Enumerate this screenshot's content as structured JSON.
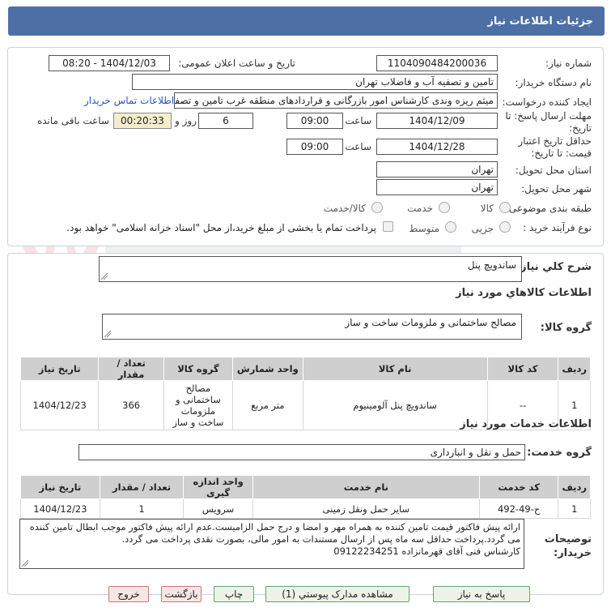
{
  "header": {
    "title": "جزئیات اطلاعات نیاز"
  },
  "labels": {
    "need_number": "شماره نیاز:",
    "announce_datetime": "تاریخ و ساعت اعلان عمومی:",
    "buyer_org": "نام دستگاه خریدار:",
    "request_creator": "ایجاد کننده درخواست:",
    "reply_deadline": "مهلت ارسال پاسخ: تا تاریخ:",
    "price_validity": "حداقل تاریخ اعتبار قیمت: تا تاریخ:",
    "time_word": "ساعت",
    "day_and": "روز و",
    "remaining": "ساعت باقی مانده",
    "delivery_province": "استان محل تحویل:",
    "delivery_city": "شهر محل تحویل:",
    "category": "طبقه بندی موضوعی:",
    "purchase_process": "نوع فرآیند خرید :",
    "general_desc": "شرح کلي نياز:",
    "goods_info": "اطلاعات کالاهاي مورد نياز",
    "goods_group": "گروه کالا:",
    "services_info": "اطلاعات خدمات مورد نياز",
    "service_group": "گروه خدمت:",
    "buyer_notes": "توضیحات خریدار:"
  },
  "fields": {
    "need_number": "1104090484200036",
    "announce_datetime": "1404/12/03 - 08:20",
    "buyer_org": "تامین و تصفیه آب و فاضلاب تهران",
    "request_creator": "میثم ریزه وندی کارشناس امور بازرگانی و قراردادهای منطقه غرب تامین و تصفیه",
    "contact_link": "اطلاعات تماس خریدار",
    "reply_date": "1404/12/09",
    "reply_time": "09:00",
    "reply_days": "6",
    "reply_remaining": "00:20:33",
    "validity_date": "1404/12/28",
    "validity_time": "09:00",
    "province": "تهران",
    "city": "تهران"
  },
  "category_options": [
    "کالا",
    "خدمت",
    "کالا/خدمت"
  ],
  "process_options": [
    "جزیی",
    "متوسط"
  ],
  "process_note": "پرداخت تمام یا بخشی از مبلغ خرید،از محل \"اسناد خزانه اسلامی\" خواهد بود.",
  "general_desc": "ساندویچ پنل",
  "goods_group": "مصالح ساختمانی و ملزومات ساخت و ساز",
  "goods_table": {
    "headers": [
      "ردیف",
      "کد کالا",
      "نام کالا",
      "واحد شمارش",
      "گروه کالا",
      "تعداد / مقدار",
      "تاریخ نیاز"
    ],
    "rows": [
      [
        "1",
        "--",
        "ساندویچ پنل آلومینیوم",
        "متر مربع",
        "مصالح ساختمانی و ملزومات ساخت و ساز",
        "366",
        "1404/12/23"
      ]
    ]
  },
  "service_group": "حمل و نقل و انبارداری",
  "services_table": {
    "headers": [
      "ردیف",
      "کد خدمت",
      "نام خدمت",
      "واحد اندازه گیری",
      "تعداد / مقدار",
      "تاریخ نیاز"
    ],
    "rows": [
      [
        "1",
        "ح-49-492",
        "سایر حمل ونقل زمینی",
        "سرویس",
        "1",
        "1404/12/23"
      ]
    ]
  },
  "buyer_notes": [
    "ارائه پیش فاکتور قیمت تامین کننده به همراه مهر و امضا و درج حمل الزامیست.عدم ارائه پیش فاکتور موجب ابطال تامین کننده",
    "می گردد.پرداخت حداقل سه ماه پس از ارسال مستندات به امور مالی، بصورت نقدی پرداخت می گردد.",
    "کارشناس فنی آقای قهرمانزاده 09122234251"
  ],
  "buttons": {
    "reply": "پاسخ به نیاز",
    "view_docs": "مشاهده مدارک پیوستي (1)",
    "print": "چاپ",
    "back": "بازگشت",
    "exit": "خروج"
  },
  "colors": {
    "header_bg": "#4e6fa6",
    "link": "#2255cc",
    "timer_bg": "#f5eecc"
  }
}
